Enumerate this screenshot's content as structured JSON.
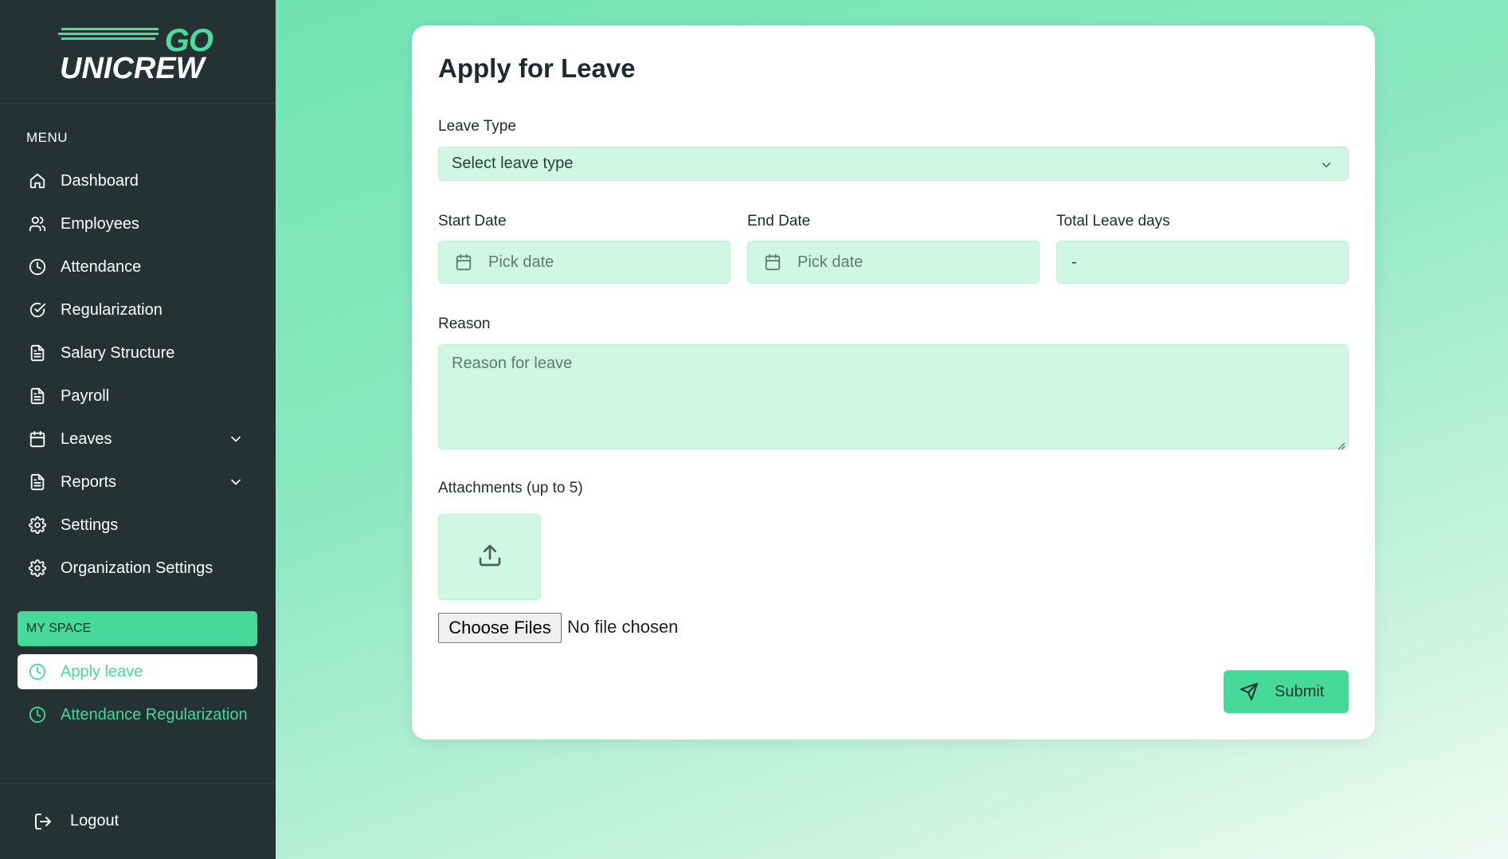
{
  "brand": {
    "logo_go": "GO",
    "logo_name": "UNICREW",
    "accent_color": "#47d99a",
    "sidebar_bg": "#243234"
  },
  "sidebar": {
    "menu_title": "MENU",
    "items": [
      {
        "label": "Dashboard",
        "icon": "home-icon"
      },
      {
        "label": "Employees",
        "icon": "users-icon"
      },
      {
        "label": "Attendance",
        "icon": "clock-icon"
      },
      {
        "label": "Regularization",
        "icon": "check-circle-icon"
      },
      {
        "label": "Salary Structure",
        "icon": "file-icon"
      },
      {
        "label": "Payroll",
        "icon": "file-icon"
      },
      {
        "label": "Leaves",
        "icon": "calendar-icon",
        "expandable": true
      },
      {
        "label": "Reports",
        "icon": "file-icon",
        "expandable": true
      },
      {
        "label": "Settings",
        "icon": "gear-icon"
      },
      {
        "label": "Organization Settings",
        "icon": "gear-icon"
      }
    ],
    "myspace_title": "MY SPACE",
    "myspace_items": [
      {
        "label": "Apply leave",
        "icon": "clock-icon",
        "active": true
      },
      {
        "label": "Attendance Regularization",
        "icon": "clock-icon",
        "active": false
      }
    ],
    "logout_label": "Logout"
  },
  "form": {
    "title": "Apply for Leave",
    "leave_type_label": "Leave Type",
    "leave_type_placeholder": "Select leave type",
    "start_date_label": "Start Date",
    "start_date_placeholder": "Pick date",
    "end_date_label": "End Date",
    "end_date_placeholder": "Pick date",
    "total_days_label": "Total Leave days",
    "total_days_value": "-",
    "reason_label": "Reason",
    "reason_placeholder": "Reason for leave",
    "attachments_label": "Attachments (up to 5)",
    "choose_files_label": "Choose Files",
    "no_file_text": "No file chosen",
    "submit_label": "Submit"
  }
}
